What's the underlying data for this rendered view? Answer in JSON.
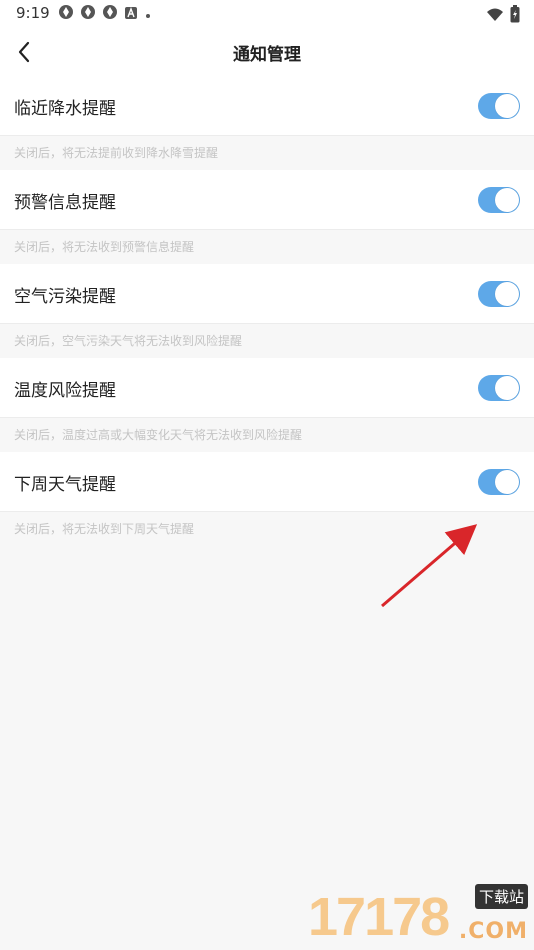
{
  "status_bar": {
    "time": "9:19",
    "icons": [
      "app-icon",
      "app-icon",
      "app-icon",
      "a-icon",
      "dot-icon"
    ],
    "right_icons": [
      "wifi-icon",
      "battery-icon"
    ]
  },
  "header": {
    "title": "通知管理",
    "back_icon": "chevron-left-icon"
  },
  "settings": [
    {
      "label": "临近降水提醒",
      "enabled": true,
      "hint": "关闭后，将无法提前收到降水降雪提醒"
    },
    {
      "label": "预警信息提醒",
      "enabled": true,
      "hint": "关闭后，将无法收到预警信息提醒"
    },
    {
      "label": "空气污染提醒",
      "enabled": true,
      "hint": "关闭后，空气污染天气将无法收到风险提醒"
    },
    {
      "label": "温度风险提醒",
      "enabled": true,
      "hint": "关闭后，温度过高或大幅变化天气将无法收到风险提醒"
    },
    {
      "label": "下周天气提醒",
      "enabled": true,
      "hint": "关闭后，将无法收到下周天气提醒"
    }
  ],
  "colors": {
    "toggle_on": "#5ea8e8",
    "arrow": "#d9262a",
    "hint_text": "#c4c4c4"
  },
  "watermark": {
    "digits": "17178",
    "badge": "下载站",
    "com": ".COM"
  }
}
